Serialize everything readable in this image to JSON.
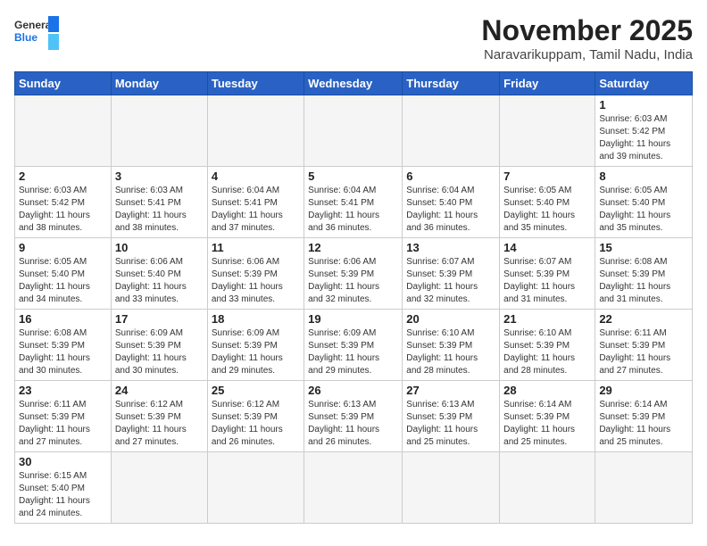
{
  "header": {
    "logo_general": "General",
    "logo_blue": "Blue",
    "month_title": "November 2025",
    "subtitle": "Naravarikuppam, Tamil Nadu, India"
  },
  "weekdays": [
    "Sunday",
    "Monday",
    "Tuesday",
    "Wednesday",
    "Thursday",
    "Friday",
    "Saturday"
  ],
  "weeks": [
    [
      {
        "day": "",
        "info": ""
      },
      {
        "day": "",
        "info": ""
      },
      {
        "day": "",
        "info": ""
      },
      {
        "day": "",
        "info": ""
      },
      {
        "day": "",
        "info": ""
      },
      {
        "day": "",
        "info": ""
      },
      {
        "day": "1",
        "info": "Sunrise: 6:03 AM\nSunset: 5:42 PM\nDaylight: 11 hours\nand 39 minutes."
      }
    ],
    [
      {
        "day": "2",
        "info": "Sunrise: 6:03 AM\nSunset: 5:42 PM\nDaylight: 11 hours\nand 38 minutes."
      },
      {
        "day": "3",
        "info": "Sunrise: 6:03 AM\nSunset: 5:41 PM\nDaylight: 11 hours\nand 38 minutes."
      },
      {
        "day": "4",
        "info": "Sunrise: 6:04 AM\nSunset: 5:41 PM\nDaylight: 11 hours\nand 37 minutes."
      },
      {
        "day": "5",
        "info": "Sunrise: 6:04 AM\nSunset: 5:41 PM\nDaylight: 11 hours\nand 36 minutes."
      },
      {
        "day": "6",
        "info": "Sunrise: 6:04 AM\nSunset: 5:40 PM\nDaylight: 11 hours\nand 36 minutes."
      },
      {
        "day": "7",
        "info": "Sunrise: 6:05 AM\nSunset: 5:40 PM\nDaylight: 11 hours\nand 35 minutes."
      },
      {
        "day": "8",
        "info": "Sunrise: 6:05 AM\nSunset: 5:40 PM\nDaylight: 11 hours\nand 35 minutes."
      }
    ],
    [
      {
        "day": "9",
        "info": "Sunrise: 6:05 AM\nSunset: 5:40 PM\nDaylight: 11 hours\nand 34 minutes."
      },
      {
        "day": "10",
        "info": "Sunrise: 6:06 AM\nSunset: 5:40 PM\nDaylight: 11 hours\nand 33 minutes."
      },
      {
        "day": "11",
        "info": "Sunrise: 6:06 AM\nSunset: 5:39 PM\nDaylight: 11 hours\nand 33 minutes."
      },
      {
        "day": "12",
        "info": "Sunrise: 6:06 AM\nSunset: 5:39 PM\nDaylight: 11 hours\nand 32 minutes."
      },
      {
        "day": "13",
        "info": "Sunrise: 6:07 AM\nSunset: 5:39 PM\nDaylight: 11 hours\nand 32 minutes."
      },
      {
        "day": "14",
        "info": "Sunrise: 6:07 AM\nSunset: 5:39 PM\nDaylight: 11 hours\nand 31 minutes."
      },
      {
        "day": "15",
        "info": "Sunrise: 6:08 AM\nSunset: 5:39 PM\nDaylight: 11 hours\nand 31 minutes."
      }
    ],
    [
      {
        "day": "16",
        "info": "Sunrise: 6:08 AM\nSunset: 5:39 PM\nDaylight: 11 hours\nand 30 minutes."
      },
      {
        "day": "17",
        "info": "Sunrise: 6:09 AM\nSunset: 5:39 PM\nDaylight: 11 hours\nand 30 minutes."
      },
      {
        "day": "18",
        "info": "Sunrise: 6:09 AM\nSunset: 5:39 PM\nDaylight: 11 hours\nand 29 minutes."
      },
      {
        "day": "19",
        "info": "Sunrise: 6:09 AM\nSunset: 5:39 PM\nDaylight: 11 hours\nand 29 minutes."
      },
      {
        "day": "20",
        "info": "Sunrise: 6:10 AM\nSunset: 5:39 PM\nDaylight: 11 hours\nand 28 minutes."
      },
      {
        "day": "21",
        "info": "Sunrise: 6:10 AM\nSunset: 5:39 PM\nDaylight: 11 hours\nand 28 minutes."
      },
      {
        "day": "22",
        "info": "Sunrise: 6:11 AM\nSunset: 5:39 PM\nDaylight: 11 hours\nand 27 minutes."
      }
    ],
    [
      {
        "day": "23",
        "info": "Sunrise: 6:11 AM\nSunset: 5:39 PM\nDaylight: 11 hours\nand 27 minutes."
      },
      {
        "day": "24",
        "info": "Sunrise: 6:12 AM\nSunset: 5:39 PM\nDaylight: 11 hours\nand 27 minutes."
      },
      {
        "day": "25",
        "info": "Sunrise: 6:12 AM\nSunset: 5:39 PM\nDaylight: 11 hours\nand 26 minutes."
      },
      {
        "day": "26",
        "info": "Sunrise: 6:13 AM\nSunset: 5:39 PM\nDaylight: 11 hours\nand 26 minutes."
      },
      {
        "day": "27",
        "info": "Sunrise: 6:13 AM\nSunset: 5:39 PM\nDaylight: 11 hours\nand 25 minutes."
      },
      {
        "day": "28",
        "info": "Sunrise: 6:14 AM\nSunset: 5:39 PM\nDaylight: 11 hours\nand 25 minutes."
      },
      {
        "day": "29",
        "info": "Sunrise: 6:14 AM\nSunset: 5:39 PM\nDaylight: 11 hours\nand 25 minutes."
      }
    ],
    [
      {
        "day": "30",
        "info": "Sunrise: 6:15 AM\nSunset: 5:40 PM\nDaylight: 11 hours\nand 24 minutes."
      },
      {
        "day": "",
        "info": ""
      },
      {
        "day": "",
        "info": ""
      },
      {
        "day": "",
        "info": ""
      },
      {
        "day": "",
        "info": ""
      },
      {
        "day": "",
        "info": ""
      },
      {
        "day": "",
        "info": ""
      }
    ]
  ]
}
